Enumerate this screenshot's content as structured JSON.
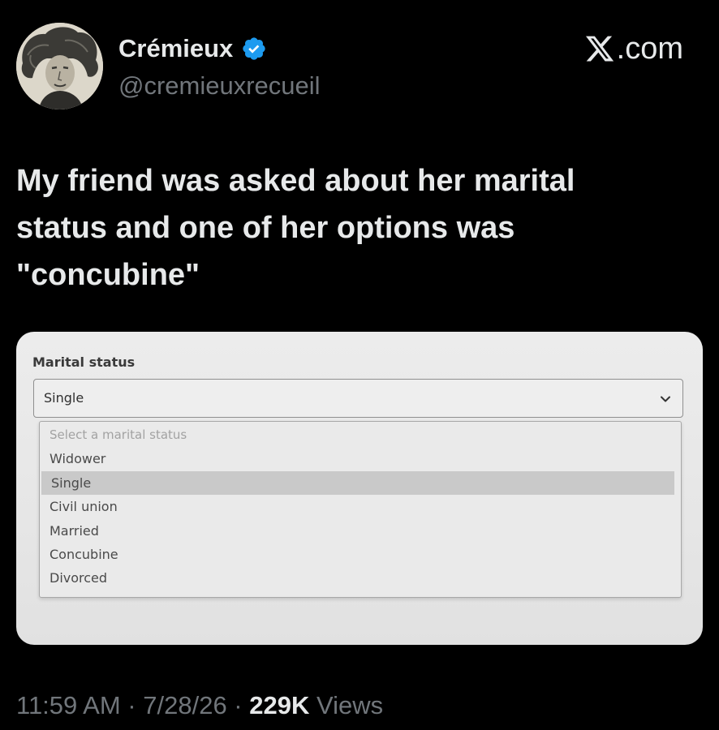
{
  "brand": {
    "label": ".com",
    "icon": "x-logo-icon"
  },
  "author": {
    "display_name": "Crémieux",
    "handle": "@cremieuxrecueil",
    "verified_icon": "verified-badge-icon",
    "avatar": "avatar-portrait"
  },
  "tweet": {
    "text": "My friend was asked about her marital\nstatus and one of her options was\n\"concubine\""
  },
  "photo": {
    "field_label": "Marital status",
    "selected_value": "Single",
    "options": [
      {
        "label": "Select a marital status",
        "placeholder": true
      },
      {
        "label": "Widower"
      },
      {
        "label": "Single",
        "selected": true
      },
      {
        "label": "Civil union"
      },
      {
        "label": "Married"
      },
      {
        "label": "Concubine"
      },
      {
        "label": "Divorced"
      }
    ]
  },
  "meta": {
    "time": "11:59 AM",
    "separator": " · ",
    "date": "7/28/26",
    "views_count": "229K",
    "views_label": "Views"
  },
  "colors": {
    "background": "#000000",
    "primary_text": "#e7e9ea",
    "secondary_text": "#71767b",
    "verified_blue": "#1d9bf0"
  }
}
